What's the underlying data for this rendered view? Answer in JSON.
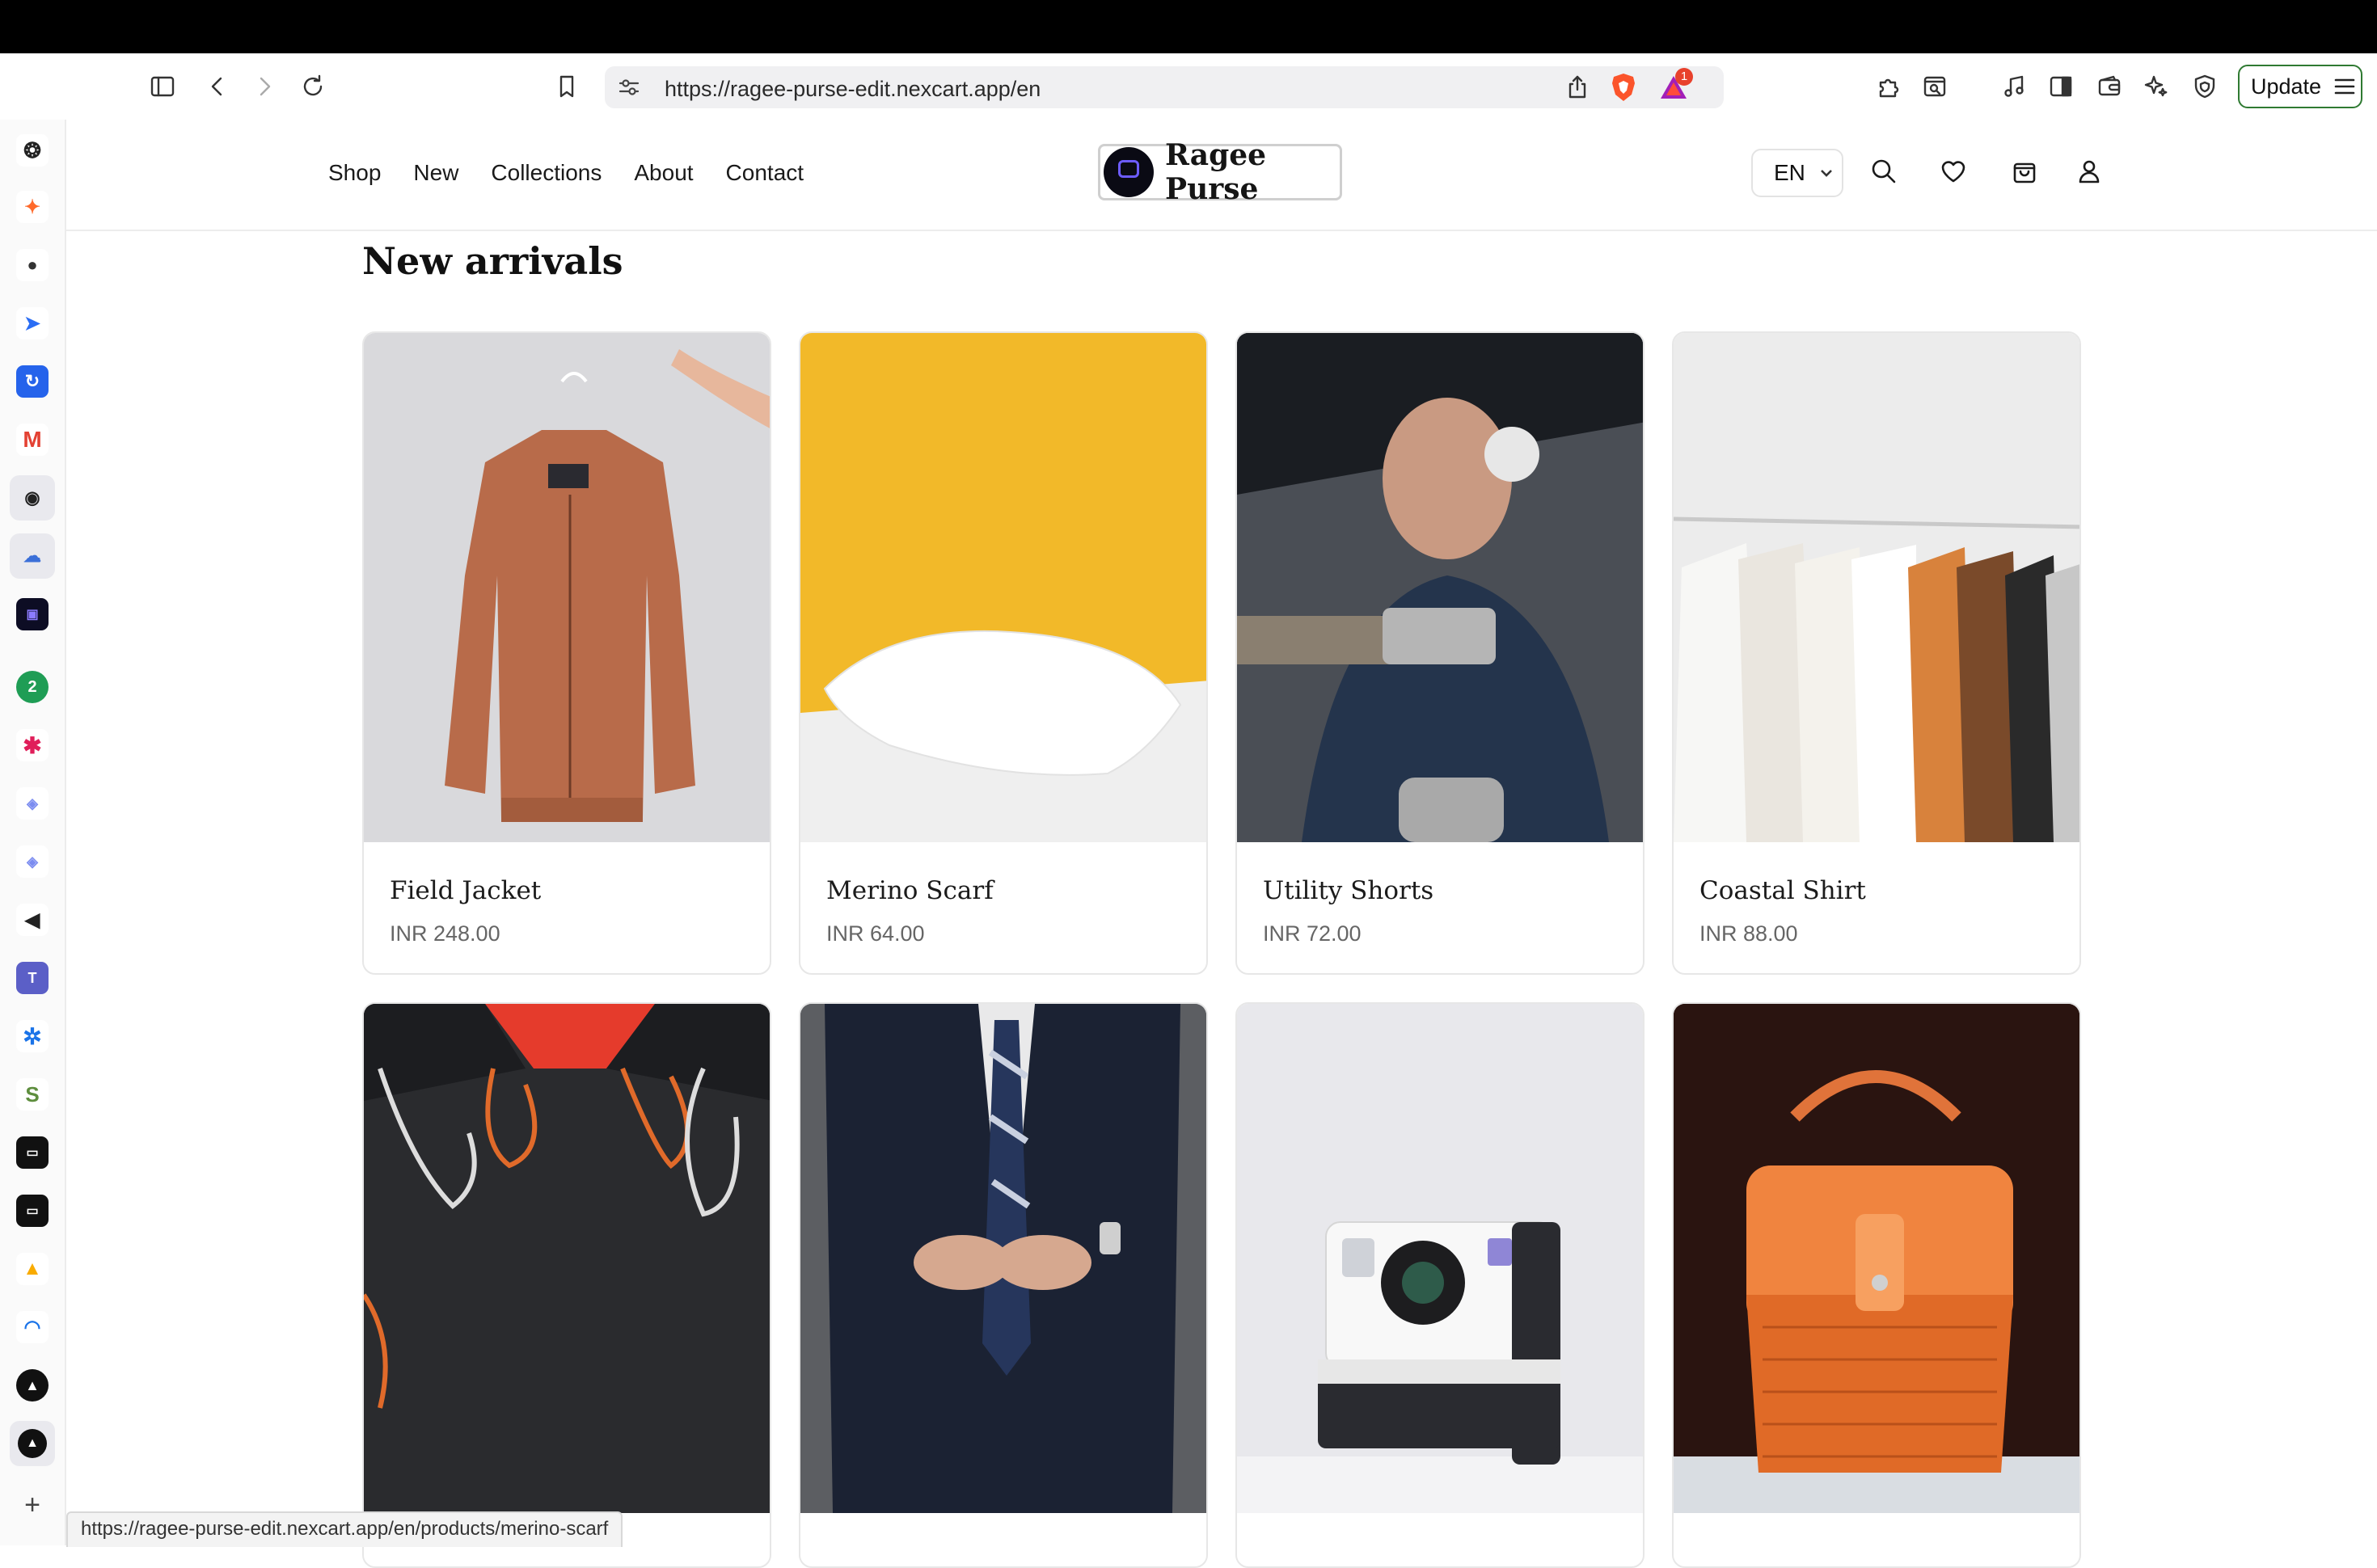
{
  "browser": {
    "url": "https://ragee-purse-edit.nexcart.app/en",
    "update_label": "Update",
    "rewards_badge": "1",
    "status_url": "https://ragee-purse-edit.nexcart.app/en/products/merino-scarf"
  },
  "site": {
    "brand": "Ragee Purse",
    "nav": [
      "Shop",
      "New",
      "Collections",
      "About",
      "Contact"
    ],
    "language": "EN"
  },
  "section": {
    "title": "New arrivals"
  },
  "products": [
    {
      "name": "Field Jacket",
      "price": "INR 248.00"
    },
    {
      "name": "Merino Scarf",
      "price": "INR 64.00"
    },
    {
      "name": "Utility Shorts",
      "price": "INR 72.00"
    },
    {
      "name": "Coastal Shirt",
      "price": "INR 88.00"
    }
  ],
  "colors": {
    "accent_update": "#2f7a32",
    "price_text": "#666666"
  }
}
